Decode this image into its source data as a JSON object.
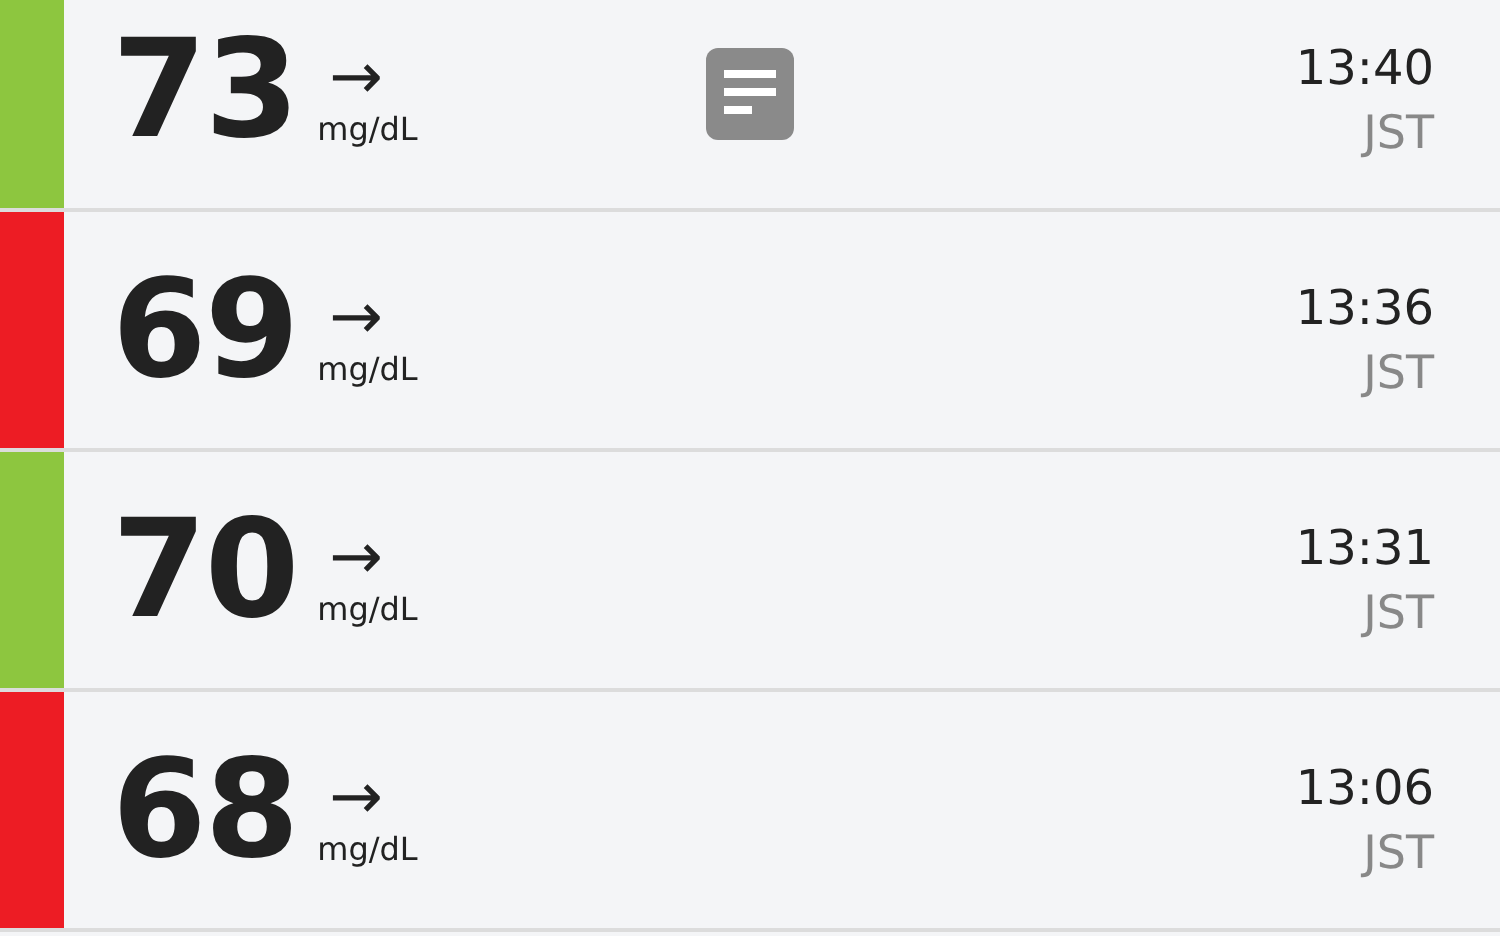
{
  "readings": [
    {
      "value": "73",
      "trend": "→",
      "unit": "mg/dL",
      "has_note": true,
      "color": "#8dc63f",
      "time": "13:40",
      "zone": "JST"
    },
    {
      "value": "69",
      "trend": "→",
      "unit": "mg/dL",
      "has_note": false,
      "color": "#ed1c24",
      "time": "13:36",
      "zone": "JST"
    },
    {
      "value": "70",
      "trend": "→",
      "unit": "mg/dL",
      "has_note": false,
      "color": "#8dc63f",
      "time": "13:31",
      "zone": "JST"
    },
    {
      "value": "68",
      "trend": "→",
      "unit": "mg/dL",
      "has_note": false,
      "color": "#ed1c24",
      "time": "13:06",
      "zone": "JST"
    }
  ]
}
